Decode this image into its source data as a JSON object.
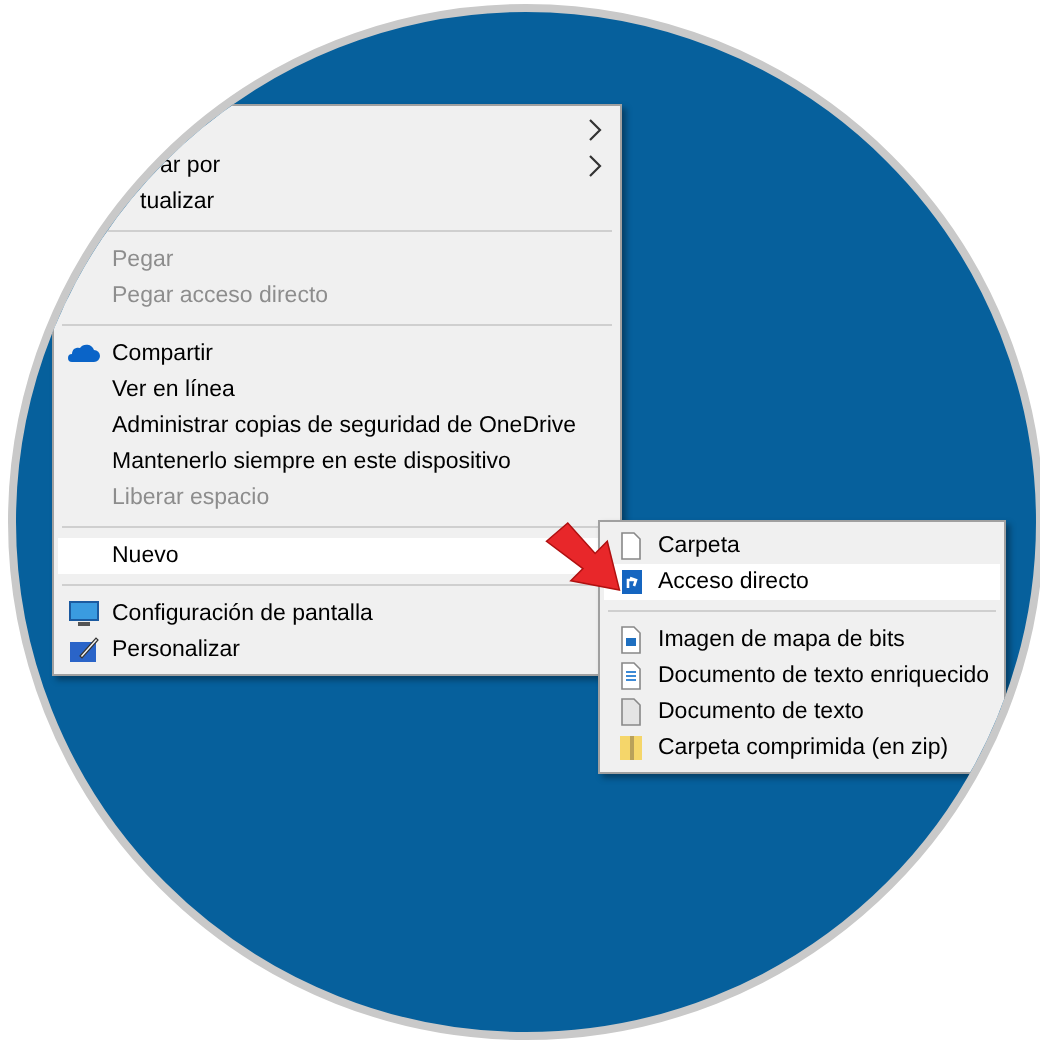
{
  "context_menu": {
    "items": [
      {
        "kind": "item",
        "disabled": false,
        "selected": false,
        "submenu": true
      },
      {
        "kind": "item",
        "label": "ar por",
        "disabled": false,
        "selected": false,
        "submenu": true
      },
      {
        "kind": "item",
        "label": "tualizar",
        "disabled": false,
        "selected": false,
        "submenu": false
      },
      {
        "kind": "separator"
      },
      {
        "kind": "item",
        "label": "Pegar",
        "disabled": true,
        "selected": false,
        "submenu": false
      },
      {
        "kind": "item",
        "label": "Pegar acceso directo",
        "disabled": true,
        "selected": false,
        "submenu": false
      },
      {
        "kind": "separator"
      },
      {
        "kind": "item",
        "label": "Compartir",
        "disabled": false,
        "selected": false,
        "submenu": false
      },
      {
        "kind": "item",
        "label": "Ver en línea",
        "disabled": false,
        "selected": false,
        "submenu": false
      },
      {
        "kind": "item",
        "label": "Administrar copias de seguridad de OneDrive",
        "disabled": false,
        "selected": false,
        "submenu": false
      },
      {
        "kind": "item",
        "label": "Mantenerlo siempre en este dispositivo",
        "disabled": false,
        "selected": false,
        "submenu": false
      },
      {
        "kind": "item",
        "label": "Liberar espacio",
        "disabled": true,
        "selected": false,
        "submenu": false
      },
      {
        "kind": "separator"
      },
      {
        "kind": "item",
        "label": "Nuevo",
        "disabled": false,
        "selected": true,
        "submenu": false
      },
      {
        "kind": "separator"
      },
      {
        "kind": "item",
        "label": "Configuración de pantalla",
        "disabled": false,
        "selected": false,
        "submenu": false
      },
      {
        "kind": "item",
        "label": "Personalizar",
        "disabled": false,
        "selected": false,
        "submenu": false
      }
    ]
  },
  "submenu": {
    "items": [
      {
        "kind": "item",
        "label": "Carpeta",
        "selected": false
      },
      {
        "kind": "item",
        "label": "Acceso directo",
        "selected": true
      },
      {
        "kind": "separator"
      },
      {
        "kind": "item",
        "label": "Imagen de mapa de bits",
        "selected": false
      },
      {
        "kind": "item",
        "label": "Documento de texto enriquecido",
        "selected": false
      },
      {
        "kind": "item",
        "label": "Documento de texto",
        "selected": false
      },
      {
        "kind": "item",
        "label": "Carpeta comprimida (en zip)",
        "selected": false
      }
    ]
  }
}
